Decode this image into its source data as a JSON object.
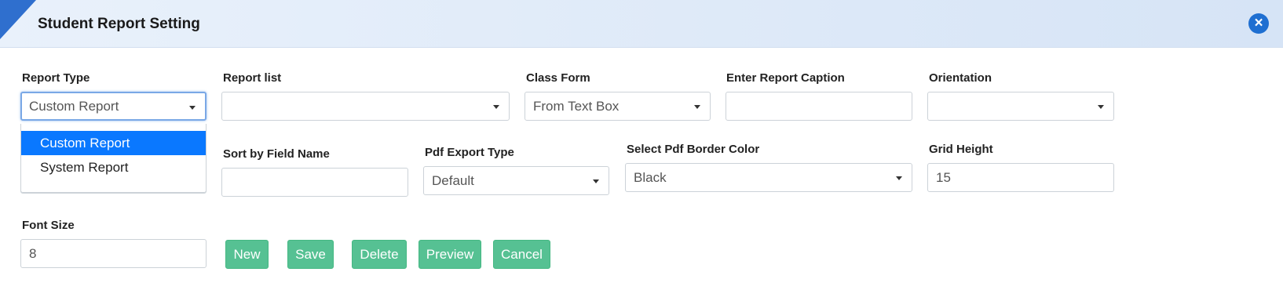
{
  "header": {
    "title": "Student Report Setting"
  },
  "colors": {
    "header_accent": "#2f6fce",
    "close_button": "#1f6fd1",
    "button_green": "#56c193",
    "selected_option": "#0a78ff"
  },
  "fields": {
    "report_type": {
      "label": "Report Type",
      "value": "Custom Report"
    },
    "report_list": {
      "label": "Report list",
      "value": ""
    },
    "class_form": {
      "label": "Class Form",
      "value": "From Text Box"
    },
    "report_caption": {
      "label": "Enter Report Caption",
      "value": ""
    },
    "orientation": {
      "label": "Orientation",
      "value": ""
    },
    "sort_by": {
      "label": "Sort by Field Name",
      "value": ""
    },
    "pdf_export_type": {
      "label": "Pdf Export Type",
      "value": "Default"
    },
    "pdf_border_color": {
      "label": "Select Pdf Border Color",
      "value": "Black"
    },
    "grid_height": {
      "label": "Grid Height",
      "value": "15"
    },
    "font_size": {
      "label": "Font Size",
      "value": "8"
    }
  },
  "report_type_dropdown": {
    "options": [
      "Custom Report",
      "System Report"
    ],
    "selected": "Custom Report"
  },
  "buttons": {
    "new": "New",
    "save": "Save",
    "delete": "Delete",
    "preview": "Preview",
    "cancel": "Cancel"
  },
  "icons": {
    "close": "close-icon"
  }
}
